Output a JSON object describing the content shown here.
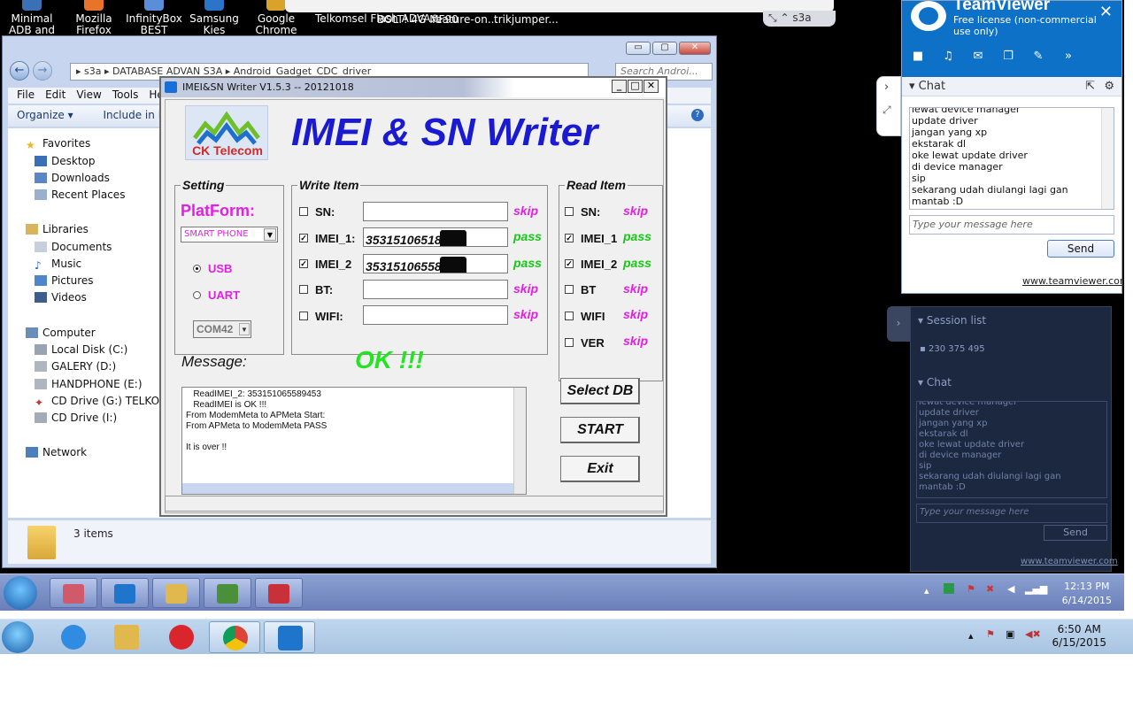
{
  "desktop": {
    "icons": [
      {
        "label": "Minimal ADB and Fastboot"
      },
      {
        "label": "Mozilla Firefox"
      },
      {
        "label": "InfinityBox BEST"
      },
      {
        "label": "Samsung Kies"
      },
      {
        "label": "Google Chrome"
      },
      {
        "label": "Telkomsel Flash ADVA..."
      },
      {
        "label": "BOLT! 4G MF90"
      },
      {
        "label": "feature-on..."
      },
      {
        "label": "trikjumper..."
      }
    ],
    "tab_fragment": "s3a"
  },
  "explorer": {
    "breadcrumb": "▸  s3a  ▸  DATABASE ADVAN S3A  ▸  Android_Gadget_CDC_driver",
    "search_placeholder": "Search Androi...",
    "menu": [
      "File",
      "Edit",
      "View",
      "Tools",
      "Hel"
    ],
    "toolbar": {
      "organize": "Organize ▾",
      "include": "Include in libra"
    },
    "tree": {
      "favorites": "Favorites",
      "desktop": "Desktop",
      "downloads": "Downloads",
      "recent": "Recent Places",
      "libraries": "Libraries",
      "documents": "Documents",
      "music": "Music",
      "pictures": "Pictures",
      "videos": "Videos",
      "computer": "Computer",
      "local_disk": "Local Disk (C:)",
      "galery": "GALERY (D:)",
      "handphone": "HANDPHONE (E:)",
      "cd_g": "CD Drive (G:) TELKOMSEL",
      "cd_i": "CD Drive (I:)",
      "network": "Network"
    },
    "status_count": "3 items"
  },
  "imei_tool": {
    "title": "IMEI&SN Writer V1.5.3 -- 20121018",
    "brand": "CK Telecom",
    "headline": "IMEI & SN Writer",
    "setting": {
      "title": "Setting",
      "platform_label": "PlatForm:",
      "platform_value": "SMART PHONE",
      "usb": "USB",
      "uart": "UART",
      "com_port": "COM42"
    },
    "write_item": {
      "title": "Write Item",
      "rows": [
        {
          "label": "SN:",
          "checked": false,
          "value": "",
          "status": "skip"
        },
        {
          "label": "IMEI_1:",
          "checked": true,
          "value": "35315106518",
          "status": "pass"
        },
        {
          "label": "IMEI_2",
          "checked": true,
          "value": "35315106558",
          "status": "pass"
        },
        {
          "label": "BT:",
          "checked": false,
          "value": "",
          "status": "skip"
        },
        {
          "label": "WIFI:",
          "checked": false,
          "value": "",
          "status": "skip"
        }
      ]
    },
    "read_item": {
      "title": "Read Item",
      "rows": [
        {
          "label": "SN:",
          "checked": false,
          "status": "skip"
        },
        {
          "label": "IMEI_1",
          "checked": true,
          "status": "pass"
        },
        {
          "label": "IMEI_2",
          "checked": true,
          "status": "pass"
        },
        {
          "label": "BT",
          "checked": false,
          "status": "skip"
        },
        {
          "label": "WIFI",
          "checked": false,
          "status": "skip"
        },
        {
          "label": "VER",
          "checked": false,
          "status": "skip"
        }
      ]
    },
    "message_label": "Message:",
    "ok_text": "OK !!!",
    "log": [
      "   ReadIMEI_2: 353151065589453",
      "   ReadIMEI is OK !!!",
      "From ModemMeta to APMeta Start:",
      "From APMeta to ModemMeta PASS",
      "",
      "It is over !!"
    ],
    "buttons": {
      "select_db": "Select DB",
      "start": "START",
      "exit": "Exit"
    }
  },
  "remote_taskbar": {
    "clock_time": "12:13 PM",
    "clock_date": "6/14/2015"
  },
  "teamviewer": {
    "brand": "TeamViewer",
    "license": "Free license (non-commercial use only)",
    "chat_title": "Chat",
    "messages": [
      "lewat device manager",
      "update driver",
      "jangan yang xp",
      "ekstarak dl",
      "oke lewat update driver",
      "di device manager",
      "sip",
      "sekarang udah diulangi lagi gan",
      "mantab :D"
    ],
    "input_placeholder": "Type your message here",
    "send": "Send",
    "site": "www.teamviewer.com"
  },
  "teamviewer_remote": {
    "session_list": "Session list",
    "session_id": "230 375 495",
    "chat_title": "Chat",
    "messages": [
      "lewat device manager",
      "update driver",
      "jangan yang xp",
      "ekstarak dl",
      "oke lewat update driver",
      "di device manager",
      "sip",
      "sekarang udah diulangi lagi gan",
      "mantab :D"
    ],
    "input_placeholder": "Type your message here",
    "send": "Send",
    "site": "www.teamviewer.com"
  },
  "local_taskbar": {
    "clock_time": "6:50 AM",
    "clock_date": "6/15/2015"
  },
  "colors": {
    "skip": "#e51ee5",
    "pass": "#15c915",
    "headline": "#1a1ad1",
    "ok": "#22e522"
  }
}
